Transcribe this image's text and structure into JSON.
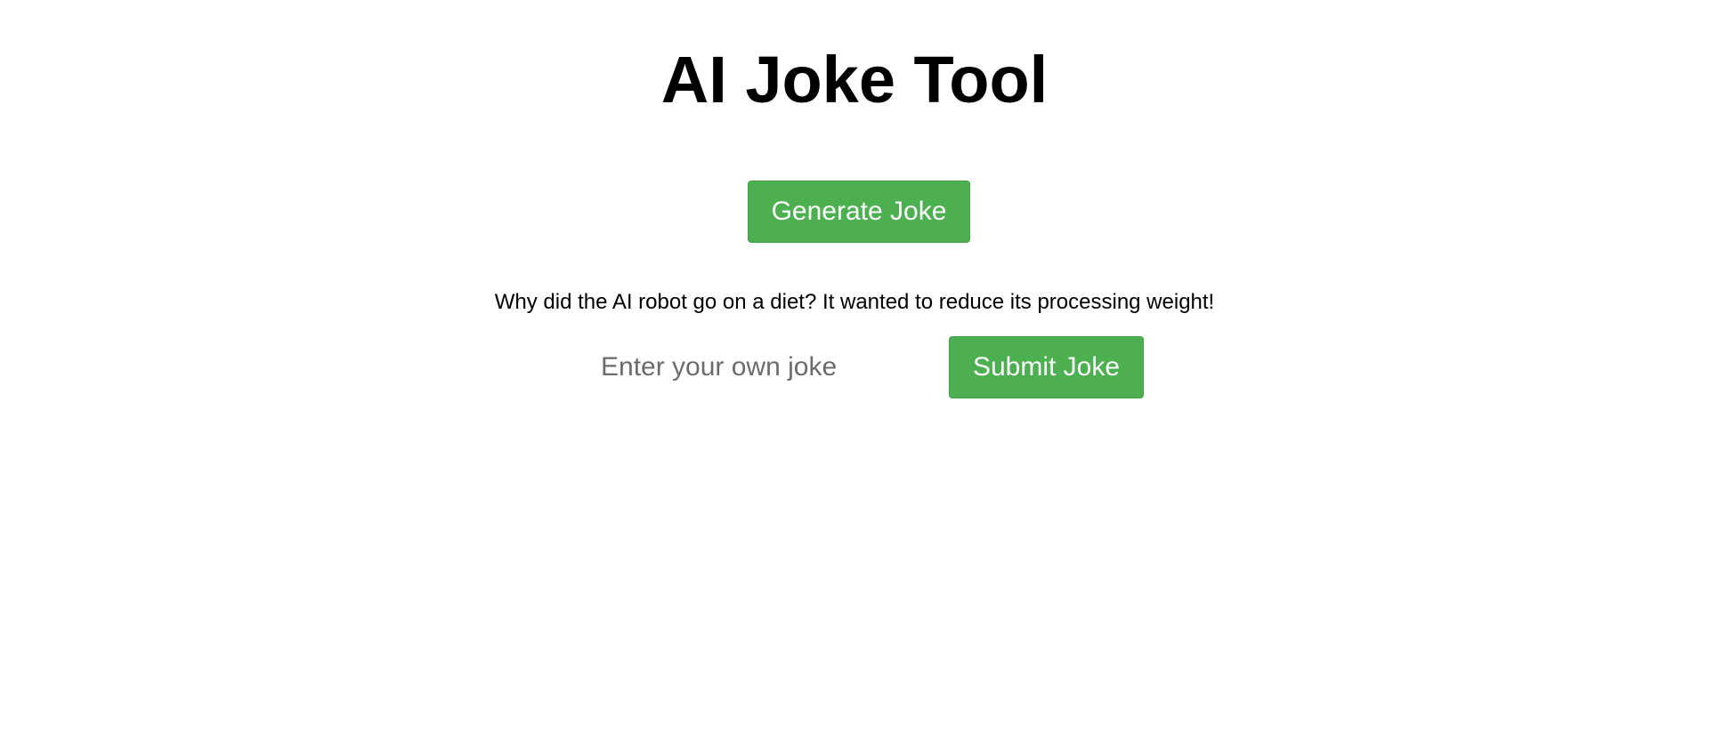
{
  "page": {
    "title": "AI Joke Tool"
  },
  "generator": {
    "button_label": "Generate Joke",
    "joke_text": "Why did the AI robot go on a diet? It wanted to reduce its processing weight!"
  },
  "submission": {
    "input_value": "",
    "input_placeholder": "Enter your own joke",
    "button_label": "Submit Joke"
  },
  "colors": {
    "button_background": "#4caf50",
    "button_text": "#ffffff",
    "page_background": "#ffffff",
    "text": "#000000",
    "placeholder": "#6b6b6b"
  }
}
